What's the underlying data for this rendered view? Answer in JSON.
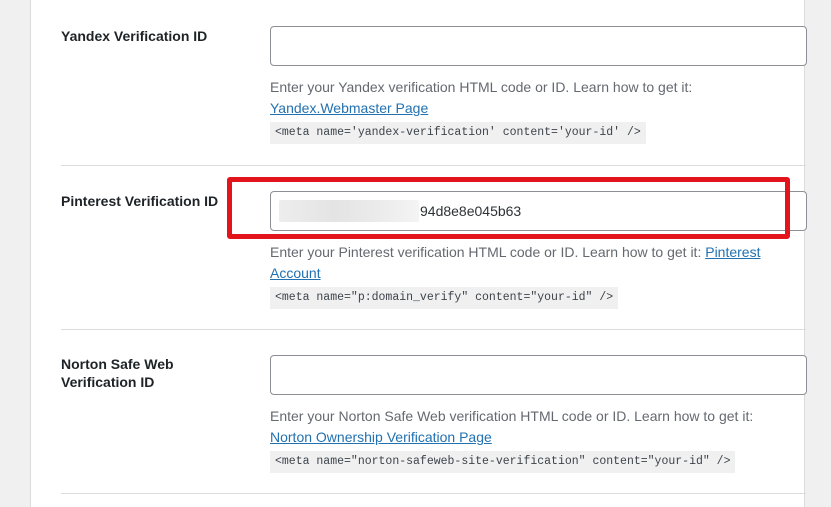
{
  "yandex": {
    "label": "Yandex Verification ID",
    "value": "",
    "desc_text": "Enter your Yandex verification HTML code or ID. Learn how to get it: ",
    "link_text": "Yandex.Webmaster Page",
    "code": "<meta name='yandex-verification' content='your-id' />"
  },
  "pinterest": {
    "label": "Pinterest Verification ID",
    "value": "94d8e8e045b63",
    "desc_text": "Enter your Pinterest verification HTML code or ID. Learn how to get it: ",
    "link_text": "Pinterest Account",
    "code": "<meta name=\"p:domain_verify\" content=\"your-id\" />"
  },
  "norton": {
    "label": "Norton Safe Web Verification ID",
    "value": "",
    "desc_text": "Enter your Norton Safe Web verification HTML code or ID. Learn how to get it: ",
    "link_text": "Norton Ownership Verification Page",
    "code": "<meta name=\"norton-safeweb-site-verification\" content=\"your-id\" />"
  },
  "colors": {
    "highlight": "#e3141b",
    "link": "#2271b1"
  }
}
